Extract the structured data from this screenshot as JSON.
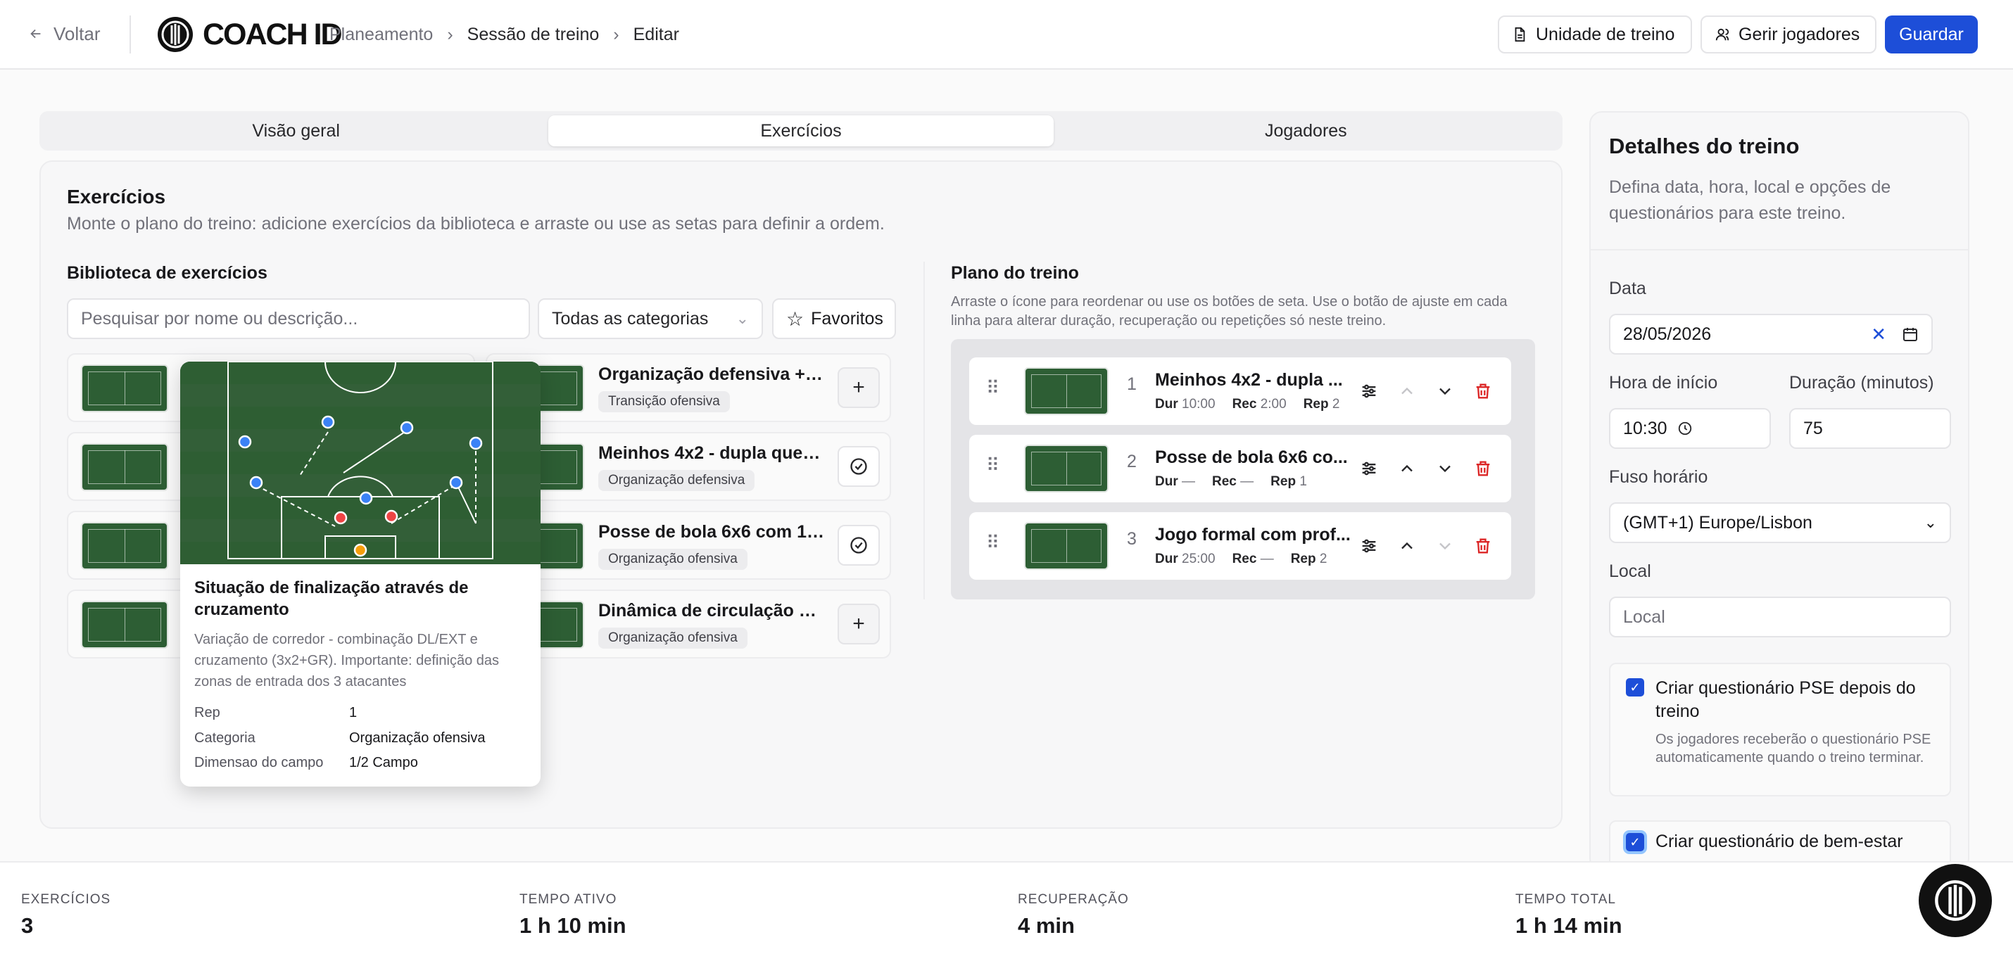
{
  "header": {
    "back": "Voltar",
    "brand": "COACH ID",
    "breadcrumbs": [
      "Planeamento",
      "Sessão de treino",
      "Editar"
    ],
    "unit_button": "Unidade de treino",
    "players_button": "Gerir jogadores",
    "save_button": "Guardar"
  },
  "tabs": [
    "Visão geral",
    "Exercícios",
    "Jogadores"
  ],
  "exercises": {
    "title": "Exercícios",
    "subtitle": "Monte o plano do treino: adicione exercícios da biblioteca e arraste ou use as setas para definir a ordem.",
    "library": {
      "title": "Biblioteca de exercícios",
      "search_placeholder": "Pesquisar por nome ou descrição...",
      "category_select": "Todas as categorias",
      "favorites": "Favoritos",
      "items": [
        {
          "title": "Organização defensiva + T...",
          "tag": "Transição ofensiva",
          "action": "add"
        },
        {
          "title": "Meinhos 4x2 - dupla que p...",
          "tag": "Organização defensiva",
          "action": "added"
        },
        {
          "title": "Posse de bola 6x6 com 1 Jk",
          "tag": "Organização ofensiva",
          "action": "added"
        },
        {
          "title": "Dinâmica de circulação of...",
          "tag": "Organização ofensiva",
          "action": "add"
        }
      ]
    },
    "plan": {
      "title": "Plano do treino",
      "hint": "Arraste o ícone para reordenar ou use os botões de seta. Use o botão de ajuste em cada linha para alterar duração, recuperação ou repetições só neste treino.",
      "labels": {
        "dur": "Dur",
        "rec": "Rec",
        "rep": "Rep"
      },
      "items": [
        {
          "n": "1",
          "title": "Meinhos 4x2 - dupla ...",
          "dur": "10:00",
          "rec": "2:00",
          "rep": "2"
        },
        {
          "n": "2",
          "title": "Posse de bola 6x6 co...",
          "dur": "—",
          "rec": "—",
          "rep": "1"
        },
        {
          "n": "3",
          "title": "Jogo formal com prof...",
          "dur": "25:00",
          "rec": "—",
          "rep": "2"
        }
      ]
    }
  },
  "popup": {
    "title": "Situação de finalização através de cruzamento",
    "description": "Variação de corredor - combinação DL/EXT e cruzamento (3x2+GR). Importante: definição das zonas de entrada dos 3 atacantes",
    "rows": [
      {
        "k": "Rep",
        "v": "1"
      },
      {
        "k": "Categoria",
        "v": "Organização ofensiva"
      },
      {
        "k": "Dimensao do campo",
        "v": "1/2 Campo"
      }
    ]
  },
  "details": {
    "title": "Detalhes do treino",
    "subtitle": "Defina data, hora, local e opções de questionários para este treino.",
    "date_label": "Data",
    "date": "28/05/2026",
    "start_label": "Hora de início",
    "start": "10:30",
    "duration_label": "Duração (minutos)",
    "duration": "75",
    "tz_label": "Fuso horário",
    "tz": "(GMT+1) Europe/Lisbon",
    "place_label": "Local",
    "place_placeholder": "Local",
    "pse_label": "Criar questionário PSE depois do treino",
    "pse_desc": "Os jogadores receberão o questionário PSE automaticamente quando o treino terminar.",
    "wellbeing_label": "Criar questionário de bem-estar"
  },
  "stats": [
    {
      "label": "EXERCÍCIOS",
      "value": "3"
    },
    {
      "label": "TEMPO ATIVO",
      "value": "1 h 10 min"
    },
    {
      "label": "RECUPERAÇÃO",
      "value": "4 min"
    },
    {
      "label": "TEMPO TOTAL",
      "value": "1 h 14 min"
    }
  ],
  "colors": {
    "accent": "#1d4ed8",
    "delete": "#dc2626",
    "pitch": "#2e5e33"
  }
}
